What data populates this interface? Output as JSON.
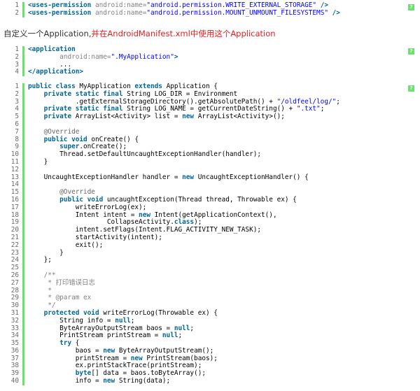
{
  "help_label": "?",
  "block1": {
    "lines": [
      {
        "n": "1",
        "html": "<span class=\"kw\">&lt;uses-permission</span> <span class=\"pl\">android:name=</span><span class=\"str\">\"android.permission.WRITE_EXTERNAL_STORAGE\"</span> <span class=\"kw\">/&gt;</span>"
      },
      {
        "n": "2",
        "html": "<span class=\"kw\">&lt;uses-permission</span> <span class=\"pl\">android:name=</span><span class=\"str\">\"android.permission.MOUNT_UNMOUNT_FILESYSTEMS\"</span> <span class=\"kw\">/&gt;</span>"
      }
    ]
  },
  "prose": {
    "prefix": "自定义一个Application,",
    "highlight": "并在AndroidManifest.xml中使用这个Application"
  },
  "block2": {
    "lines": [
      {
        "n": "1",
        "html": "<span class=\"kw\">&lt;application</span>"
      },
      {
        "n": "2",
        "html": "        <span class=\"pl\">android:name=</span><span class=\"str\">\".MyApplication\"</span><span class=\"kw\">&gt;</span>"
      },
      {
        "n": "3",
        "html": "        ..."
      },
      {
        "n": "4",
        "html": "<span class=\"kw\">&lt;/application&gt;</span>"
      }
    ]
  },
  "block3": {
    "lines": [
      {
        "n": "1",
        "html": "<span class=\"kw\">public class</span> MyApplication <span class=\"kw\">extends</span> Application {"
      },
      {
        "n": "2",
        "html": "    <span class=\"kw\">private static final</span> String LOG_DIR = Environment"
      },
      {
        "n": "3",
        "html": "            .getExternalStorageDirectory().getAbsolutePath() + <span class=\"str\">\"/oldfeel/log/\"</span>;"
      },
      {
        "n": "4",
        "html": "    <span class=\"kw\">private static final</span> String LOG_NAME = getCurrentDateString() + <span class=\"str\">\".txt\"</span>;"
      },
      {
        "n": "5",
        "html": "    <span class=\"kw\">private</span> ArrayList&lt;Activity&gt; list = <span class=\"kw\">new</span> ArrayList&lt;Activity&gt;();"
      },
      {
        "n": "6",
        "html": ""
      },
      {
        "n": "7",
        "html": "    <span class=\"ann\">@Override</span>"
      },
      {
        "n": "8",
        "html": "    <span class=\"kw\">public void</span> onCreate() {"
      },
      {
        "n": "9",
        "html": "        <span class=\"kw\">super</span>.onCreate();"
      },
      {
        "n": "10",
        "html": "        Thread.setDefaultUncaughtExceptionHandler(handler);"
      },
      {
        "n": "11",
        "html": "    }"
      },
      {
        "n": "12",
        "html": ""
      },
      {
        "n": "13",
        "html": "    UncaughtExceptionHandler handler = <span class=\"kw\">new</span> UncaughtExceptionHandler() {"
      },
      {
        "n": "14",
        "html": ""
      },
      {
        "n": "15",
        "html": "        <span class=\"ann\">@Override</span>"
      },
      {
        "n": "16",
        "html": "        <span class=\"kw\">public void</span> uncaughtException(Thread thread, Throwable ex) {"
      },
      {
        "n": "17",
        "html": "            writeErrorLog(ex);"
      },
      {
        "n": "18",
        "html": "            Intent intent = <span class=\"kw\">new</span> Intent(getApplicationContext(),"
      },
      {
        "n": "19",
        "html": "                    CollapseActivity.<span class=\"kw\">class</span>);"
      },
      {
        "n": "20",
        "html": "            intent.setFlags(Intent.FLAG_ACTIVITY_NEW_TASK);"
      },
      {
        "n": "21",
        "html": "            startActivity(intent);"
      },
      {
        "n": "22",
        "html": "            exit();"
      },
      {
        "n": "23",
        "html": "        }"
      },
      {
        "n": "24",
        "html": "    };"
      },
      {
        "n": "25",
        "html": ""
      },
      {
        "n": "26",
        "html": "    <span class=\"cm\">/**</span>"
      },
      {
        "n": "27",
        "html": "<span class=\"cm\">     * 打印错误日志</span>"
      },
      {
        "n": "28",
        "html": "<span class=\"cm\">     *</span>"
      },
      {
        "n": "29",
        "html": "<span class=\"cm\">     * @param ex</span>"
      },
      {
        "n": "30",
        "html": "<span class=\"cm\">     */</span>"
      },
      {
        "n": "31",
        "html": "    <span class=\"kw\">protected void</span> writeErrorLog(Throwable ex) {"
      },
      {
        "n": "32",
        "html": "        String info = <span class=\"kw\">null</span>;"
      },
      {
        "n": "33",
        "html": "        ByteArrayOutputStream baos = <span class=\"kw\">null</span>;"
      },
      {
        "n": "34",
        "html": "        PrintStream printStream = <span class=\"kw\">null</span>;"
      },
      {
        "n": "35",
        "html": "        <span class=\"kw\">try</span> {"
      },
      {
        "n": "36",
        "html": "            baos = <span class=\"kw\">new</span> ByteArrayOutputStream();"
      },
      {
        "n": "37",
        "html": "            printStream = <span class=\"kw\">new</span> PrintStream(baos);"
      },
      {
        "n": "38",
        "html": "            ex.printStackTrace(printStream);"
      },
      {
        "n": "39",
        "html": "            <span class=\"kw\">byte</span>[] data = baos.toByteArray();"
      },
      {
        "n": "40",
        "html": "            info = <span class=\"kw\">new</span> String(data);"
      }
    ]
  }
}
